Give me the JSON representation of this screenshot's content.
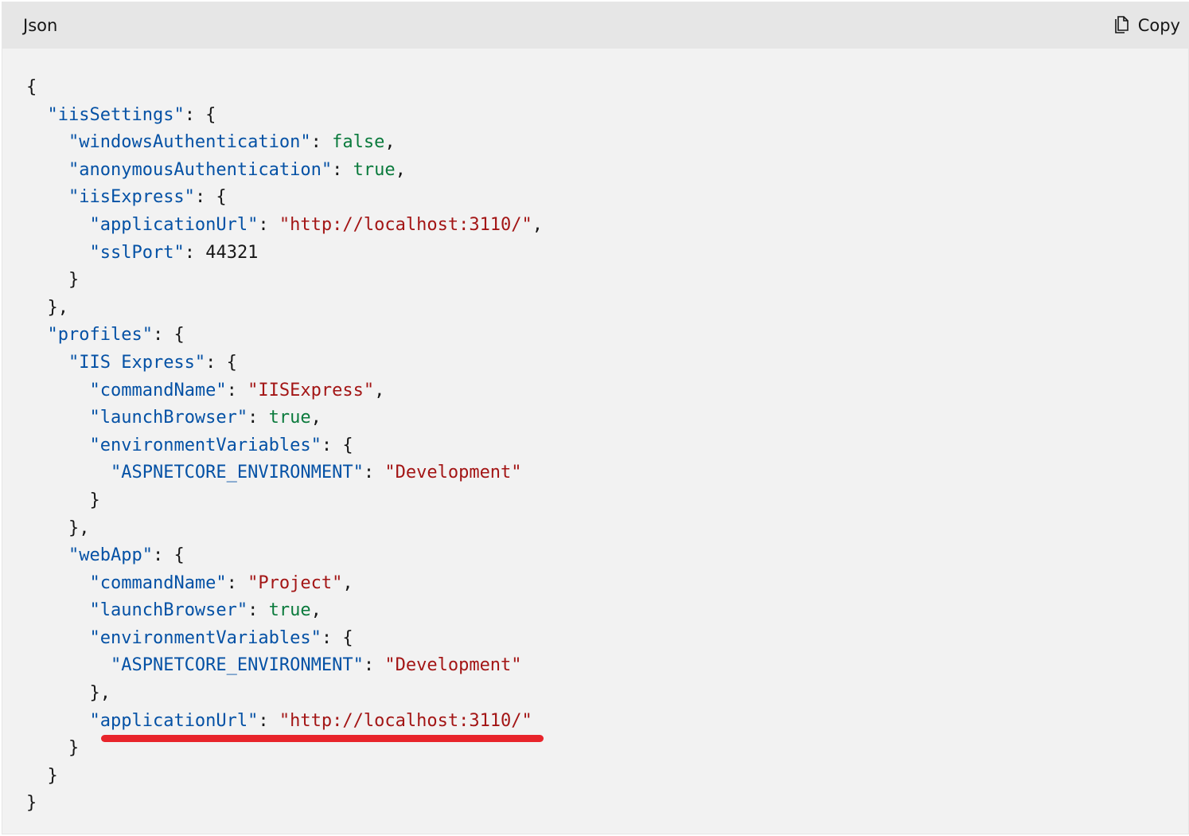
{
  "header": {
    "language": "Json",
    "copy_label": "Copy"
  },
  "colors": {
    "key": "#0451a5",
    "string": "#a31515",
    "boolean": "#0a7a3c",
    "highlight": "#e8242b"
  },
  "code": {
    "iisSettings_key": "\"iisSettings\"",
    "windowsAuthentication_key": "\"windowsAuthentication\"",
    "windowsAuthentication_val": "false",
    "anonymousAuthentication_key": "\"anonymousAuthentication\"",
    "anonymousAuthentication_val": "true",
    "iisExpress_key": "\"iisExpress\"",
    "applicationUrl_key": "\"applicationUrl\"",
    "applicationUrl_val": "\"http://localhost:3110/\"",
    "sslPort_key": "\"sslPort\"",
    "sslPort_val": "44321",
    "profiles_key": "\"profiles\"",
    "iis_express_profile_key": "\"IIS Express\"",
    "commandName_key": "\"commandName\"",
    "commandName_val_1": "\"IISExpress\"",
    "launchBrowser_key": "\"launchBrowser\"",
    "launchBrowser_val": "true",
    "environmentVariables_key": "\"environmentVariables\"",
    "aspnetcore_env_key": "\"ASPNETCORE_ENVIRONMENT\"",
    "aspnetcore_env_val": "\"Development\"",
    "webApp_key": "\"webApp\"",
    "commandName_val_2": "\"Project\"",
    "webApp_applicationUrl_val": "\"http://localhost:3110/\""
  }
}
